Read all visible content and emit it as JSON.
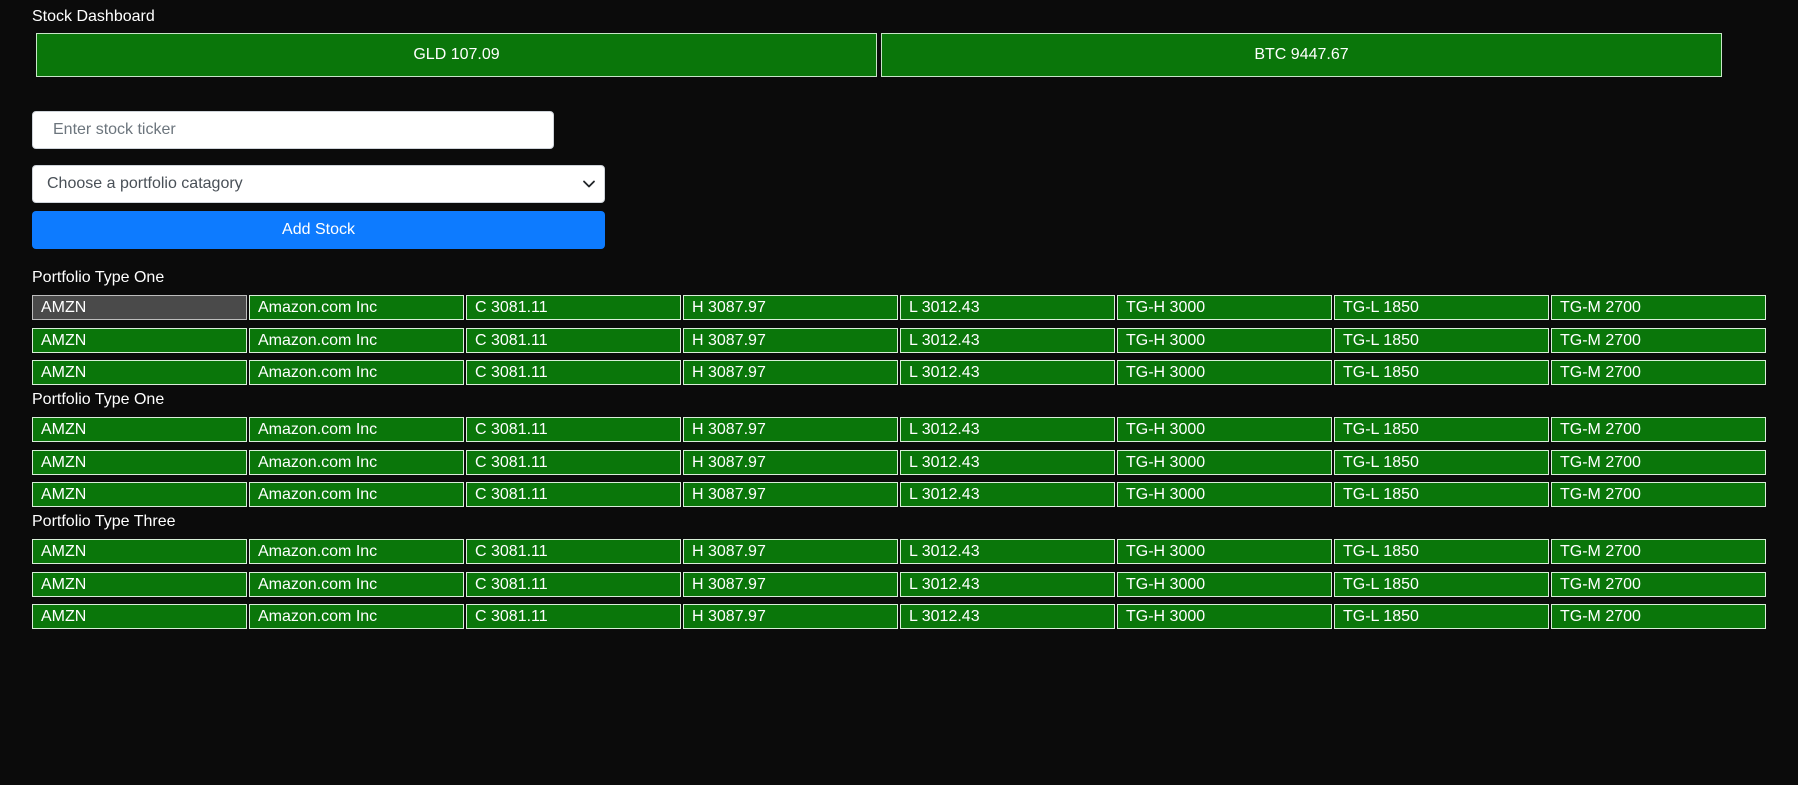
{
  "header": {
    "title": "Stock Dashboard"
  },
  "tickers": [
    {
      "label": "GLD 107.09"
    },
    {
      "label": "BTC 9447.67"
    }
  ],
  "form": {
    "ticker_placeholder": "Enter stock ticker",
    "category_selected": "Choose a portfolio catagory",
    "add_label": "Add Stock"
  },
  "portfolios": [
    {
      "label": "Portfolio Type One",
      "rows": [
        [
          "AMZN",
          "Amazon.com Inc",
          "C 3081.11",
          "H 3087.97",
          "L 3012.43",
          "TG-H 3000",
          "TG-L 1850",
          "TG-M 2700"
        ],
        [
          "AMZN",
          "Amazon.com Inc",
          "C 3081.11",
          "H 3087.97",
          "L 3012.43",
          "TG-H 3000",
          "TG-L 1850",
          "TG-M 2700"
        ],
        [
          "AMZN",
          "Amazon.com Inc",
          "C 3081.11",
          "H 3087.97",
          "L 3012.43",
          "TG-H 3000",
          "TG-L 1850",
          "TG-M 2700"
        ]
      ]
    },
    {
      "label": "Portfolio Type One",
      "rows": [
        [
          "AMZN",
          "Amazon.com Inc",
          "C 3081.11",
          "H 3087.97",
          "L 3012.43",
          "TG-H 3000",
          "TG-L 1850",
          "TG-M 2700"
        ],
        [
          "AMZN",
          "Amazon.com Inc",
          "C 3081.11",
          "H 3087.97",
          "L 3012.43",
          "TG-H 3000",
          "TG-L 1850",
          "TG-M 2700"
        ],
        [
          "AMZN",
          "Amazon.com Inc",
          "C 3081.11",
          "H 3087.97",
          "L 3012.43",
          "TG-H 3000",
          "TG-L 1850",
          "TG-M 2700"
        ]
      ]
    },
    {
      "label": "Portfolio Type Three",
      "rows": [
        [
          "AMZN",
          "Amazon.com Inc",
          "C 3081.11",
          "H 3087.97",
          "L 3012.43",
          "TG-H 3000",
          "TG-L 1850",
          "TG-M 2700"
        ],
        [
          "AMZN",
          "Amazon.com Inc",
          "C 3081.11",
          "H 3087.97",
          "L 3012.43",
          "TG-H 3000",
          "TG-L 1850",
          "TG-M 2700"
        ],
        [
          "AMZN",
          "Amazon.com Inc",
          "C 3081.11",
          "H 3087.97",
          "L 3012.43",
          "TG-H 3000",
          "TG-L 1850",
          "TG-M 2700"
        ]
      ]
    }
  ],
  "colors": {
    "background": "#0b0b0b",
    "tile_green": "#0a760a",
    "button_blue": "#0d7bff",
    "selected_cell": "#4a4a4a"
  },
  "icons": {
    "select_chevron": "chevron-down-icon"
  }
}
